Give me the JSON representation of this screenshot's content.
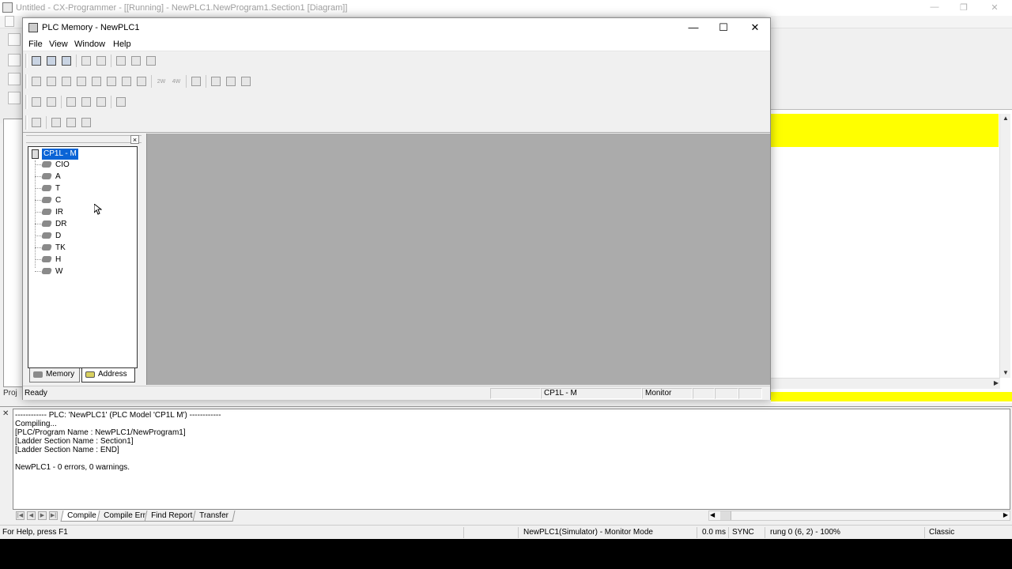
{
  "background_app": {
    "title": "Untitled - CX-Programmer - [[Running] - NewPLC1.NewProgram1.Section1 [Diagram]]",
    "win_minimize": "—",
    "win_restore": "❐",
    "win_close": "✕",
    "left_tab_label": "Proj",
    "rung_color": "#ffff00"
  },
  "window": {
    "title": "PLC Memory - NewPLC1",
    "minimize": "—",
    "maximize": "☐",
    "close": "✕",
    "menu": [
      "File",
      "View",
      "Window",
      "Help"
    ]
  },
  "toolbar": {
    "row2_labels": {
      "word": "2W",
      "dword": "4W"
    }
  },
  "tree": {
    "close": "×",
    "root_label": "CP1L - M",
    "items": [
      "CIO",
      "A",
      "T",
      "C",
      "IR",
      "DR",
      "D",
      "TK",
      "H",
      "W"
    ],
    "tabs": [
      {
        "label": "Memory",
        "icon": "memory-chip-icon"
      },
      {
        "label": "Address",
        "icon": "address-icon"
      }
    ]
  },
  "plc_status": {
    "ready": "Ready",
    "plc_model": "CP1L - M",
    "mode": "Monitor"
  },
  "output": {
    "close": "✕",
    "lines": [
      "------------ PLC: 'NewPLC1' (PLC Model 'CP1L M') ------------",
      "Compiling...",
      "[PLC/Program Name : NewPLC1/NewProgram1]",
      "[Ladder Section Name : Section1]",
      "[Ladder Section Name : END]",
      "",
      "NewPLC1 - 0 errors, 0 warnings."
    ],
    "tabs": [
      "Compile",
      "Compile Error",
      "Find Report",
      "Transfer"
    ],
    "active_tab": "Compile"
  },
  "main_status": {
    "help": "For Help, press F1",
    "connection": "NewPLC1(Simulator) - Monitor Mode",
    "cycle": "0.0 ms",
    "sync": "SYNC",
    "rung": "rung 0 (6, 2)  - 100%",
    "style": "Classic"
  }
}
